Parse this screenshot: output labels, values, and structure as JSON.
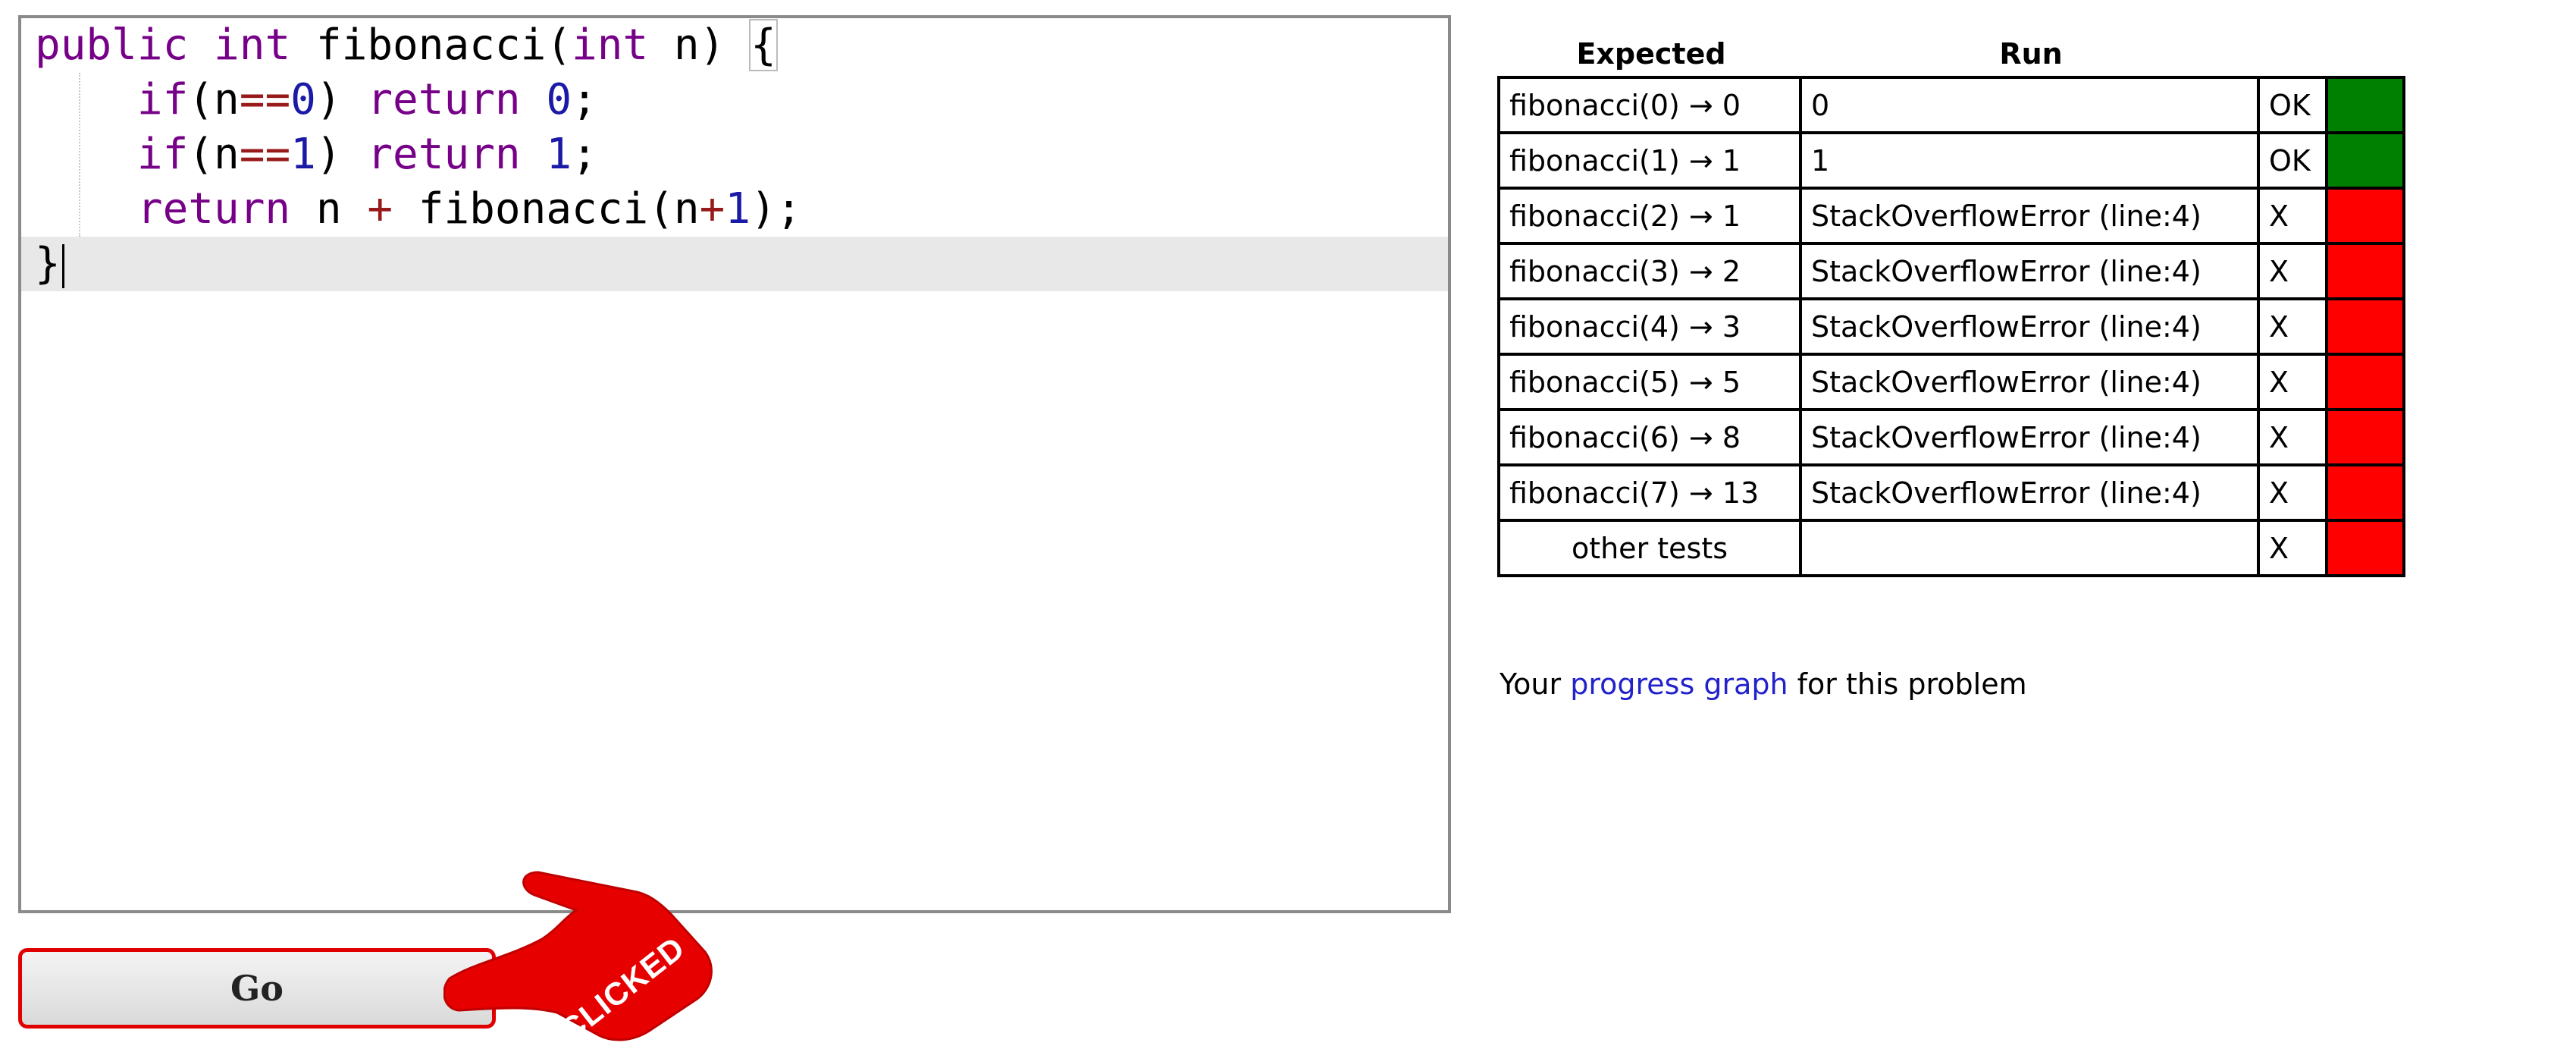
{
  "editor": {
    "lines": [
      {
        "parts": [
          [
            "kw",
            "public"
          ],
          [
            "sp",
            " "
          ],
          [
            "kw",
            "int"
          ],
          [
            "sp",
            " "
          ],
          [
            "var",
            "fibonacci"
          ],
          [
            "var",
            "("
          ],
          [
            "kw",
            "int"
          ],
          [
            "sp",
            " "
          ],
          [
            "var",
            "n"
          ],
          [
            "var",
            ") "
          ],
          [
            "bracket",
            "{"
          ]
        ]
      },
      {
        "parts": [
          [
            "sp",
            "    "
          ],
          [
            "kw",
            "if"
          ],
          [
            "var",
            "("
          ],
          [
            "var",
            "n"
          ],
          [
            "op",
            "=="
          ],
          [
            "num",
            "0"
          ],
          [
            "var",
            ") "
          ],
          [
            "kw",
            "return"
          ],
          [
            "sp",
            " "
          ],
          [
            "num",
            "0"
          ],
          [
            "var",
            ";"
          ]
        ]
      },
      {
        "parts": [
          [
            "sp",
            "    "
          ],
          [
            "kw",
            "if"
          ],
          [
            "var",
            "("
          ],
          [
            "var",
            "n"
          ],
          [
            "op",
            "=="
          ],
          [
            "num",
            "1"
          ],
          [
            "var",
            ") "
          ],
          [
            "kw",
            "return"
          ],
          [
            "sp",
            " "
          ],
          [
            "num",
            "1"
          ],
          [
            "var",
            ";"
          ]
        ]
      },
      {
        "parts": [
          [
            "sp",
            "    "
          ],
          [
            "kw",
            "return"
          ],
          [
            "sp",
            " "
          ],
          [
            "var",
            "n"
          ],
          [
            "sp",
            " "
          ],
          [
            "op",
            "+"
          ],
          [
            "sp",
            " "
          ],
          [
            "var",
            "fibonacci"
          ],
          [
            "var",
            "("
          ],
          [
            "var",
            "n"
          ],
          [
            "op",
            "+"
          ],
          [
            "num",
            "1"
          ],
          [
            "var",
            ");"
          ]
        ]
      },
      {
        "parts": [
          [
            "var",
            "}"
          ]
        ]
      }
    ]
  },
  "go_button": {
    "label": "Go"
  },
  "annotation": {
    "label": "CLICKED"
  },
  "results": {
    "headers": {
      "expected": "Expected",
      "run": "Run"
    },
    "rows": [
      {
        "expected": "fibonacci(0) → 0",
        "run": "0",
        "status": "OK",
        "passed": true
      },
      {
        "expected": "fibonacci(1) → 1",
        "run": "1",
        "status": "OK",
        "passed": true
      },
      {
        "expected": "fibonacci(2) → 1",
        "run": "StackOverflowError (line:4)",
        "status": "X",
        "passed": false
      },
      {
        "expected": "fibonacci(3) → 2",
        "run": "StackOverflowError (line:4)",
        "status": "X",
        "passed": false
      },
      {
        "expected": "fibonacci(4) → 3",
        "run": "StackOverflowError (line:4)",
        "status": "X",
        "passed": false
      },
      {
        "expected": "fibonacci(5) → 5",
        "run": "StackOverflowError (line:4)",
        "status": "X",
        "passed": false
      },
      {
        "expected": "fibonacci(6) → 8",
        "run": "StackOverflowError (line:4)",
        "status": "X",
        "passed": false
      },
      {
        "expected": "fibonacci(7) → 13",
        "run": "StackOverflowError (line:4)",
        "status": "X",
        "passed": false
      },
      {
        "expected": "other tests",
        "run": "",
        "status": "X",
        "passed": false
      }
    ]
  },
  "progress": {
    "prefix": "Your ",
    "link": "progress graph",
    "suffix": " for this problem"
  },
  "colors": {
    "pass": "#008000",
    "fail": "#ff0000",
    "button_border": "#e00000"
  }
}
